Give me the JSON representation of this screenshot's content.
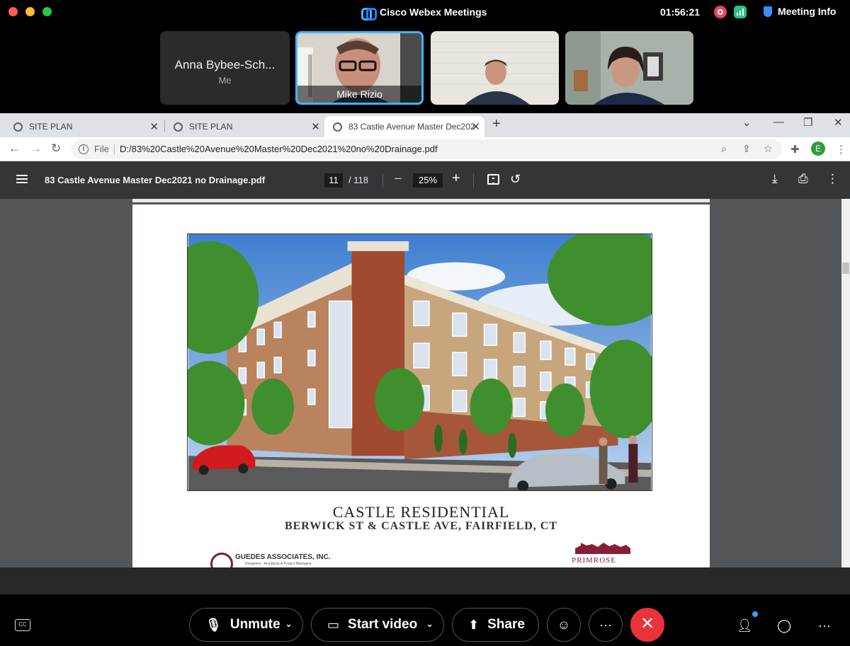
{
  "app": {
    "title": "Cisco Webex Meetings",
    "clock": "01:56:21",
    "meeting_info_label": "Meeting Info"
  },
  "participants": [
    {
      "name": "Anna Bybee-Sch...",
      "subtitle": "Me"
    },
    {
      "name": "Mike Rizio"
    },
    {
      "name": ""
    },
    {
      "name": ""
    }
  ],
  "browser": {
    "tabs": [
      {
        "title": "SITE PLAN"
      },
      {
        "title": "SITE PLAN"
      },
      {
        "title": "83 Castle Avenue Master Dec202"
      }
    ],
    "new_tab": "+",
    "protocol_label": "File",
    "url": "D:/83%20Castle%20Avenue%20Master%20Dec2021%20no%20Drainage.pdf",
    "profile_initial": "E"
  },
  "pdf": {
    "file_name": "83 Castle Avenue Master Dec2021 no Drainage.pdf",
    "current_page": "11",
    "total_pages": "/ 118",
    "zoom": "25%",
    "document": {
      "title": "CASTLE RESIDENTIAL",
      "subtitle": "BERWICK ST & CASTLE AVE, FAIRFIELD, CT",
      "firm_name": "GUEDES ASSOCIATES, INC.",
      "firm_tagline": "Designers · Architects & Project Managers",
      "developer": "PRIMROSE"
    }
  },
  "controls": {
    "cc": "CC",
    "unmute": "Unmute",
    "start_video": "Start video",
    "share": "Share",
    "more": "···",
    "leave": "✕"
  },
  "colors": {
    "active_speaker_border": "#3cb7ff",
    "leave_button": "#e8333b",
    "pdf_toolbar": "#323639",
    "pdf_background": "#525659"
  }
}
